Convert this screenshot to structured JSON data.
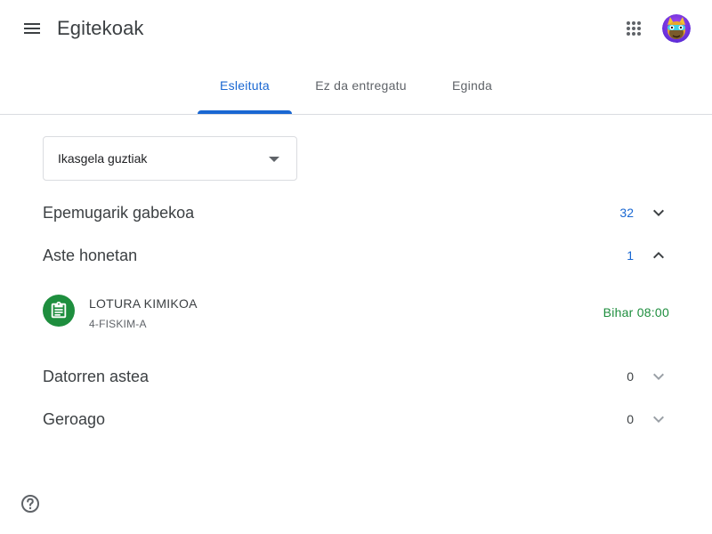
{
  "header": {
    "menu_icon": "menu-icon",
    "title": "Egitekoak",
    "apps_icon": "apps-grid-icon",
    "avatar_icon": "user-avatar"
  },
  "tabs": [
    {
      "label": "Esleituta",
      "active": true
    },
    {
      "label": "Ez da entregatu",
      "active": false
    },
    {
      "label": "Eginda",
      "active": false
    }
  ],
  "class_filter": {
    "selected": "Ikasgela guztiak",
    "icon": "dropdown-arrow-icon"
  },
  "sections": [
    {
      "title": "Epemugarik gabekoa",
      "count": "32",
      "expanded": false
    },
    {
      "title": "Aste honetan",
      "count": "1",
      "expanded": true
    },
    {
      "title": "Datorren astea",
      "count": "0",
      "expanded": false
    },
    {
      "title": "Geroago",
      "count": "0",
      "expanded": false
    }
  ],
  "assignment": {
    "title": "LOTURA KIMIKOA",
    "class_name": "4-FISKIM-A",
    "due": "Bihar 08:00",
    "icon": "assignment-icon"
  },
  "help": {
    "icon": "help-icon"
  },
  "colors": {
    "accent_blue": "#1967d2",
    "assignment_green": "#1e8e3e",
    "divider": "#dadce0",
    "text_primary": "#3c4043"
  }
}
